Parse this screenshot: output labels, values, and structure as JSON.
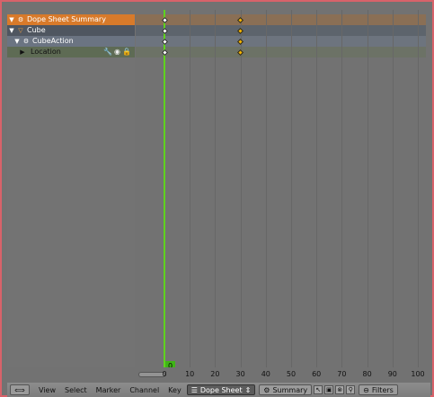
{
  "channels": [
    {
      "name": "Dope Sheet Summary",
      "icon": "summary-icon",
      "expand": "▼"
    },
    {
      "name": "Cube",
      "icon": "object-icon",
      "expand": "▼"
    },
    {
      "name": "CubeAction",
      "icon": "action-icon",
      "expand": "▼"
    },
    {
      "name": "Location",
      "icon": "group-icon",
      "expand": "▶"
    }
  ],
  "keyframes": [
    0,
    30
  ],
  "ruler": {
    "labels": [
      "0",
      "10",
      "20",
      "30",
      "40",
      "50",
      "60",
      "70",
      "80",
      "90",
      "100"
    ],
    "current_frame": "0"
  },
  "header": {
    "menus": [
      "View",
      "Select",
      "Marker",
      "Channel",
      "Key"
    ],
    "mode": "Dope Sheet",
    "summary": "Summary",
    "filters": "Filters"
  },
  "colors": {
    "playhead": "#5fd21e",
    "keyframe_selected": "#f4b400",
    "summary_row": "#d87a2a"
  }
}
